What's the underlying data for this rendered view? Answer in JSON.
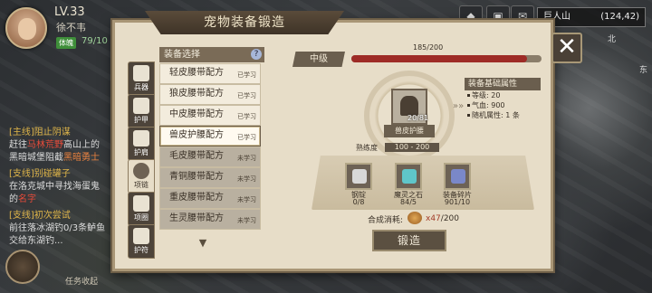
{
  "player": {
    "level": "LV.33",
    "name": "徐不韦",
    "hp_tag": "体魄",
    "hp": "79/10"
  },
  "quests": [
    {
      "head": "[主线]阻止阴谋",
      "line1a": "赶往",
      "line1b": "马林荒野",
      "line1c": "高山上的",
      "line2a": "黑暗城堡阻截",
      "line2b": "黑暗勇士"
    },
    {
      "head": "[支线]别碰罐子",
      "line1": "在洛克城中寻找海蛋鬼",
      "line2": "的",
      "line2b": "名字"
    },
    {
      "head": "[支线]初次尝试",
      "line1": "前往落冰湖钓0/3条鲈鱼",
      "line2": "交给东湖钓..."
    }
  ],
  "task_fold": "任务收起",
  "map": {
    "location": "巨人山",
    "coords": "(124,42)",
    "north": "北",
    "east": "东"
  },
  "panel": {
    "title": "宠物装备锻造",
    "close": "✕"
  },
  "tabs": [
    "兵器",
    "护甲",
    "护肩",
    "项链",
    "项圈",
    "护符"
  ],
  "list": {
    "header": "装备选择",
    "help": "?",
    "items": [
      {
        "name": "轻皮腰带配方",
        "status": "已学习"
      },
      {
        "name": "狼皮腰带配方",
        "status": "已学习"
      },
      {
        "name": "中皮腰带配方",
        "status": "已学习"
      },
      {
        "name": "兽皮护腰配方",
        "status": "已学习"
      },
      {
        "name": "毛皮腰带配方",
        "status": "未学习"
      },
      {
        "name": "青铜腰带配方",
        "status": "未学习"
      },
      {
        "name": "重皮腰带配方",
        "status": "未学习"
      },
      {
        "name": "生灵腰带配方",
        "status": "未学习"
      }
    ]
  },
  "grade": {
    "label": "中级",
    "progress_text": "185/200",
    "value": 185,
    "max": 200
  },
  "product": {
    "name": "兽皮护腰",
    "count": "20/81"
  },
  "attributes": {
    "header": "装备基础属性",
    "rows": [
      "等级: 20",
      "气血: 900",
      "随机属性: 1 条"
    ]
  },
  "proficiency": {
    "label": "熟练度",
    "range": "100 - 200"
  },
  "materials": [
    {
      "name": "钢锭",
      "count": "0/8"
    },
    {
      "name": "魔灵之石",
      "count": "84/5"
    },
    {
      "name": "装备碎片",
      "count": "901/10"
    }
  ],
  "cost": {
    "label": "合成消耗:",
    "amount": "x47",
    "total": "/200"
  },
  "forge_button": "锻造",
  "colors": {
    "grade_fill": "#9e2b26",
    "accent": "#5b5041",
    "parchment": "#e7ddc8"
  }
}
